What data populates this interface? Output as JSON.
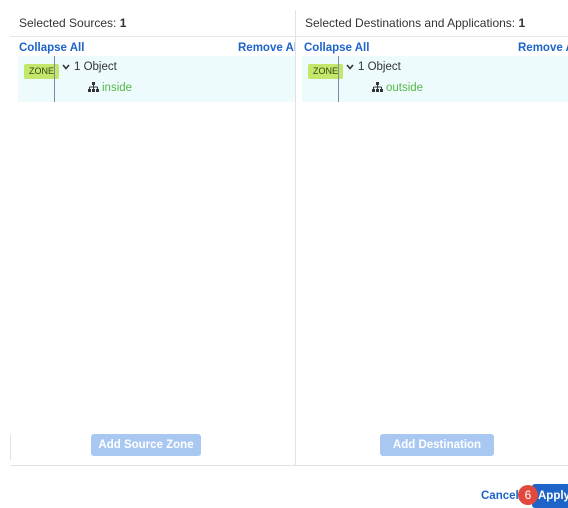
{
  "sources": {
    "header_label": "Selected Sources: ",
    "header_count": "1",
    "collapse_label": "Collapse All",
    "remove_label": "Remove All",
    "zone_badge": "ZONE",
    "object_count_label": "1 Object",
    "item_label": "inside",
    "add_button": "Add Source Zone"
  },
  "destinations": {
    "header_label": "Selected Destinations and Applications: ",
    "header_count": "1",
    "collapse_label": "Collapse All",
    "remove_label": "Remove Al",
    "zone_badge": "ZONE",
    "object_count_label": "1 Object",
    "item_label": "outside",
    "add_button": "Add Destination Zone"
  },
  "footer": {
    "cancel_label": "Cancel",
    "apply_label": "Apply",
    "step_badge": "6"
  },
  "colors": {
    "accent": "#1d63c8",
    "zone_badge": "#c3e66b",
    "group_bg": "#eefbfc",
    "item_green": "#54b948",
    "step_badge": "#e2483d",
    "add_button_disabled": "#a8c8f2"
  },
  "icons": {
    "chevron": "chevron-down-icon",
    "network": "network-tree-icon"
  }
}
